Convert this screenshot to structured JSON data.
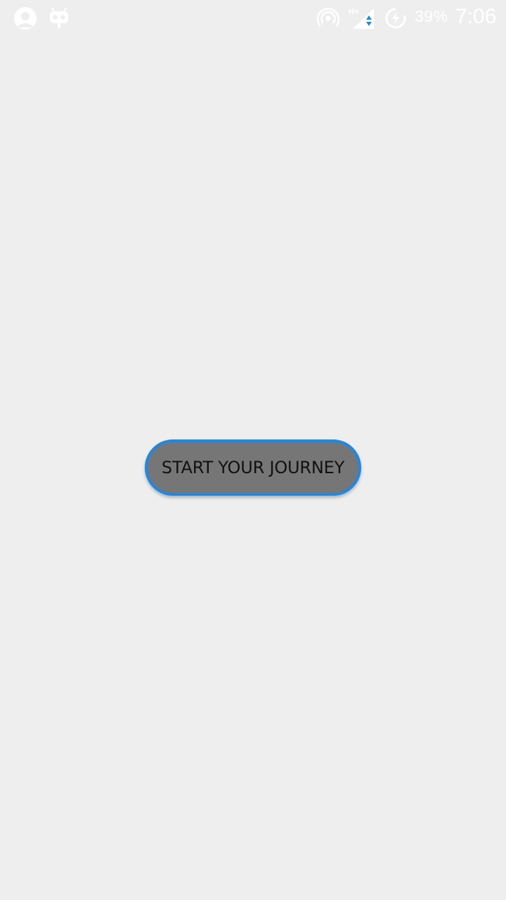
{
  "status_bar": {
    "left_icons": [
      "profile-icon",
      "cyanogen-mascot-icon"
    ],
    "right_icons": [
      "hotspot-icon",
      "mobile-signal-icon",
      "battery-charging-icon"
    ],
    "network_type": "H+",
    "battery_percent": "39%",
    "time": "7:06"
  },
  "main": {
    "start_button_label": "START YOUR JOURNEY"
  },
  "colors": {
    "background": "#eeeeee",
    "button_fill": "#767676",
    "button_border": "#1e88e5",
    "status_icons": "#ffffff",
    "signal_activity": "#1e88e5"
  }
}
